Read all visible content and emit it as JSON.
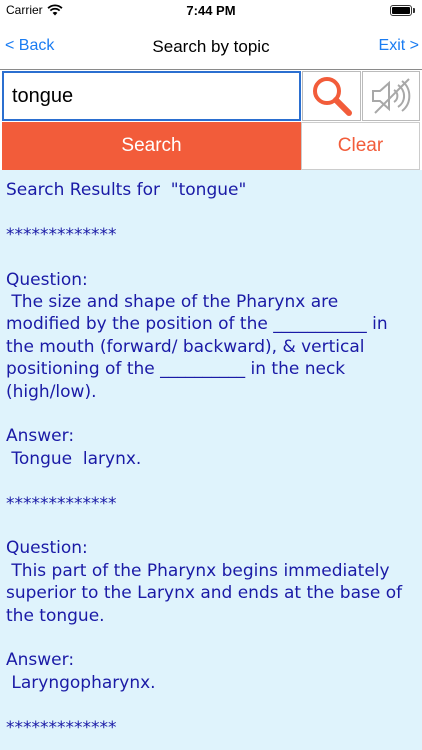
{
  "status": {
    "carrier": "Carrier",
    "time": "7:44 PM"
  },
  "nav": {
    "back_label": "< Back",
    "title": "Search by topic",
    "exit_label": "Exit >"
  },
  "search": {
    "value": "tongue",
    "search_label": "Search",
    "clear_label": "Clear"
  },
  "icons": {
    "search": "magnifier-icon",
    "speaker": "speaker-muted-icon"
  },
  "colors": {
    "accent": "#f25c3a",
    "link": "#1a7cf2",
    "result_text": "#1a1aa6",
    "result_bg": "#dff3fc",
    "input_border": "#2b6fd0"
  },
  "results": {
    "header": "Search Results for  \"tongue\"",
    "separator": "*************",
    "question_label": "Question:",
    "answer_label": "Answer:",
    "items": [
      {
        "question": " The size and shape of the Pharynx are modified by the position of the ___________ in the mouth (forward/ backward), & vertical positioning of the __________ in the neck (high/low).",
        "answer": " Tongue  larynx."
      },
      {
        "question": " This part of the Pharynx begins immediately superior to the Larynx and ends at the base of the tongue.",
        "answer": " Laryngopharynx."
      }
    ]
  }
}
